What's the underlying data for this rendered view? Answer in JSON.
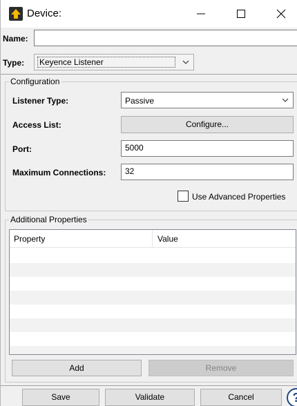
{
  "window": {
    "title": "Device:",
    "controls": {
      "minimize": "minimize",
      "maximize": "maximize",
      "close": "close"
    }
  },
  "form": {
    "name_label": "Name:",
    "name_value": "",
    "type_label": "Type:",
    "type_value": "Keyence Listener"
  },
  "configuration": {
    "group_title": "Configuration",
    "listener_type_label": "Listener Type:",
    "listener_type_value": "Passive",
    "access_list_label": "Access List:",
    "configure_button": "Configure...",
    "port_label": "Port:",
    "port_value": "5000",
    "max_connections_label": "Maximum Connections:",
    "max_connections_value": "32",
    "advanced_checkbox_label": "Use Advanced Properties",
    "advanced_checked": false
  },
  "additional_properties": {
    "group_title": "Additional Properties",
    "columns": [
      "Property",
      "Value"
    ],
    "rows": [],
    "add_button": "Add",
    "remove_button": "Remove"
  },
  "footer": {
    "save_button": "Save",
    "validate_button": "Validate",
    "cancel_button": "Cancel",
    "help_glyph": "?"
  },
  "colors": {
    "window_bg": "#f0f0f0",
    "titlebar_bg": "#ffffff",
    "icon_accent": "#f5b800",
    "help_blue": "#1a4a80"
  }
}
